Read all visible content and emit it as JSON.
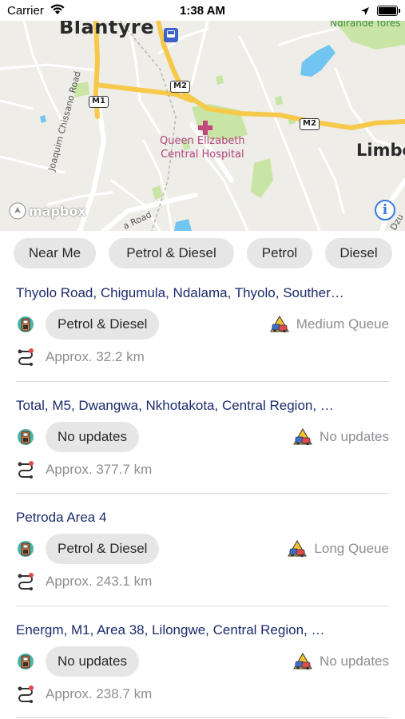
{
  "status_bar": {
    "carrier": "Carrier",
    "time": "1:38 AM"
  },
  "map": {
    "labels": {
      "blantyre": "Blantyre",
      "limbe": "Limbe",
      "hospital_line1": "Queen Elizabeth",
      "hospital_line2": "Central Hospital",
      "forest": "Ndirande fores",
      "road_chissano": "Joaquim Chissano Road",
      "road_a": "a Road",
      "road_dzu": "Dzu"
    },
    "shields": {
      "m1": "M1",
      "m2_left": "M2",
      "m2_right": "M2"
    },
    "attribution": "mapbox",
    "info_glyph": "i",
    "colors": {
      "land": "#eeede8",
      "park": "#c9e5a6",
      "water": "#71c5f0",
      "motorway": "#f6c94a"
    }
  },
  "filters": [
    {
      "label": "Near Me"
    },
    {
      "label": "Petrol & Diesel"
    },
    {
      "label": "Petrol"
    },
    {
      "label": "Diesel"
    }
  ],
  "stations": [
    {
      "name": "Thyolo Road, Chigumula, Ndalama, Thyolo, Souther…",
      "fuel": "Petrol & Diesel",
      "queue": "Medium Queue",
      "distance": "Approx. 32.2 km"
    },
    {
      "name": "Total, M5, Dwangwa, Nkhotakota, Central Region, …",
      "fuel": "No updates",
      "queue": "No updates",
      "distance": "Approx. 377.7 km"
    },
    {
      "name": "Petroda Area 4",
      "fuel": "Petrol & Diesel",
      "queue": "Long Queue",
      "distance": "Approx. 243.1 km"
    },
    {
      "name": "Energm, M1, Area 38, Lilongwe, Central Region, …",
      "fuel": "No updates",
      "queue": "No updates",
      "distance": "Approx. 238.7 km"
    }
  ]
}
